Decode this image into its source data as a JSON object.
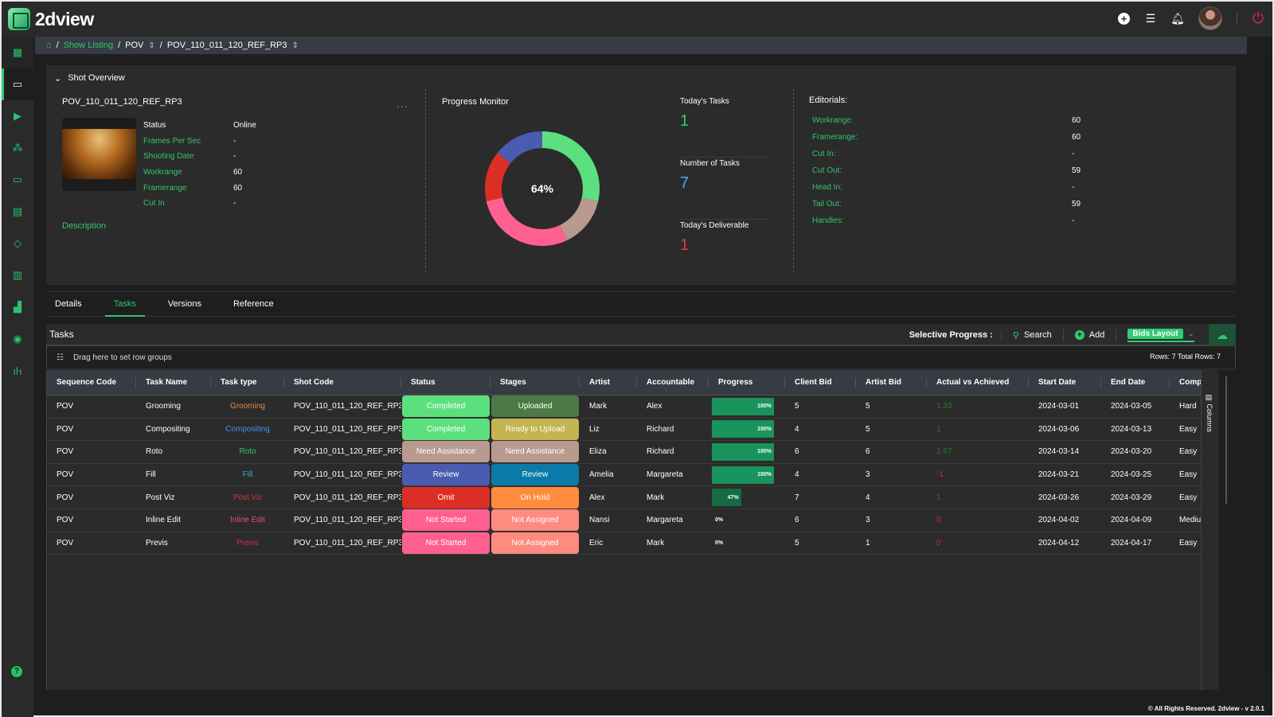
{
  "app": {
    "name": "2dview"
  },
  "topbar": {
    "icons": [
      "add-icon",
      "list-icon",
      "bell-icon",
      "avatar",
      "power-icon"
    ]
  },
  "sidebar": {
    "items": [
      {
        "name": "dashboard-icon",
        "glyph": "▦"
      },
      {
        "name": "monitor-icon",
        "glyph": "🖵"
      },
      {
        "name": "play-icon",
        "glyph": "▶"
      },
      {
        "name": "hierarchy-icon",
        "glyph": "⁂"
      },
      {
        "name": "calendar-icon",
        "glyph": "▭"
      },
      {
        "name": "schedule-icon",
        "glyph": "▤"
      },
      {
        "name": "tag-icon",
        "glyph": "◇"
      },
      {
        "name": "book-icon",
        "glyph": "▥"
      },
      {
        "name": "chart-icon",
        "glyph": "▁▃▅"
      },
      {
        "name": "eye-icon",
        "glyph": "◉"
      },
      {
        "name": "broadcast-icon",
        "glyph": "((•))"
      }
    ],
    "help": "?"
  },
  "breadcrumb": {
    "home": "⌂",
    "items": [
      "Show Listing",
      "POV",
      "POV_110_011_120_REF_RP3"
    ],
    "separator": "/"
  },
  "overview": {
    "title": "Shot Overview",
    "shot_name": "POV_110_011_120_REF_RP3",
    "more": "...",
    "fields": [
      {
        "label": "Status",
        "value": "Online"
      },
      {
        "label": "Frames Per Sec",
        "value": "-"
      },
      {
        "label": "Shooting Date",
        "value": "-"
      },
      {
        "label": "Workrange",
        "value": "60"
      },
      {
        "label": "Framerange",
        "value": "60"
      },
      {
        "label": "Cut In",
        "value": "-"
      }
    ],
    "description_label": "Description",
    "progress_monitor": {
      "title": "Progress Monitor",
      "center_label": "64%"
    },
    "stats": [
      {
        "label": "Today's Tasks",
        "value": "1",
        "color": "#2ecc71"
      },
      {
        "label": "Number of Tasks",
        "value": "7",
        "color": "#4aa8f0"
      },
      {
        "label": "Today's Deliverable",
        "value": "1",
        "color": "#e03a3a"
      }
    ],
    "editorials": {
      "title": "Editorials:",
      "rows": [
        {
          "label": "Workrange:",
          "value": "60"
        },
        {
          "label": "Framerange:",
          "value": "60"
        },
        {
          "label": "Cut In:",
          "value": "-"
        },
        {
          "label": "Cut Out:",
          "value": "59"
        },
        {
          "label": "Head In:",
          "value": "-"
        },
        {
          "label": "Tail Out:",
          "value": "59"
        },
        {
          "label": "Handles:",
          "value": "-"
        }
      ]
    }
  },
  "chart_data": {
    "type": "pie",
    "title": "Progress Monitor",
    "center_label": "64%",
    "categories": [
      "Completed",
      "Need Assistance",
      "Not Started",
      "Omit",
      "Review"
    ],
    "values": [
      2,
      1,
      2,
      1,
      1
    ],
    "colors": [
      "#5ce07f",
      "#b89a8e",
      "#ff6090",
      "#dc2e24",
      "#4a5cb0"
    ]
  },
  "tabs": [
    {
      "label": "Details",
      "active": false
    },
    {
      "label": "Tasks",
      "active": true
    },
    {
      "label": "Versions",
      "active": false
    },
    {
      "label": "Reference",
      "active": false
    }
  ],
  "tasks": {
    "title": "Tasks",
    "selective_progress": "Selective Progress :",
    "search_label": "Search",
    "add_label": "Add",
    "layout_label": "Bids Layout",
    "group_hint": "Drag here to set row groups",
    "rows_info": "Rows: 7   Total Rows: 7",
    "columns_panel": "Columns",
    "columns": [
      "Sequence Code",
      "Task Name",
      "Task type",
      "Shot Code",
      "Status",
      "Stages",
      "Artist",
      "Accountable",
      "Progress",
      "Client Bid",
      "Artist Bid",
      "Actual vs Achieved",
      "Start Date",
      "End Date",
      "Complexi"
    ],
    "rows": [
      {
        "seq": "POV",
        "task": "Grooming",
        "type": "Grooming",
        "type_color": "#e88a3a",
        "shot": "POV_110_011_120_REF_RP3",
        "status": "Completed",
        "status_color": "#5ce07f",
        "stage": "Uploaded",
        "stage_color": "#4b7a44",
        "artist": "Mark",
        "accountable": "Alex",
        "progress": 100,
        "progress_label": "100%",
        "client_bid": "5",
        "artist_bid": "5",
        "ava": "1.33",
        "ava_color": "#2a7a2a",
        "start": "2024-03-01",
        "end": "2024-03-05",
        "complexity": "Hard"
      },
      {
        "seq": "POV",
        "task": "Compositing",
        "type": "Compositing",
        "type_color": "#4a8ef0",
        "shot": "POV_110_011_120_REF_RP3",
        "status": "Completed",
        "status_color": "#5ce07f",
        "stage": "Ready to Upload",
        "stage_color": "#c4b452",
        "artist": "Liz",
        "accountable": "Richard",
        "progress": 100,
        "progress_label": "100%",
        "client_bid": "4",
        "artist_bid": "5",
        "ava": "1",
        "ava_color": "#2a7a2a",
        "start": "2024-03-06",
        "end": "2024-03-13",
        "complexity": "Easy"
      },
      {
        "seq": "POV",
        "task": "Roto",
        "type": "Roto",
        "type_color": "#3cc45a",
        "shot": "POV_110_011_120_REF_RP3",
        "status": "Need Assistance",
        "status_color": "#b89a8e",
        "stage": "Need Assistance",
        "stage_color": "#b89a8e",
        "artist": "Eliza",
        "accountable": "Richard",
        "progress": 100,
        "progress_label": "100%",
        "client_bid": "6",
        "artist_bid": "6",
        "ava": "1.67",
        "ava_color": "#2a7a2a",
        "start": "2024-03-14",
        "end": "2024-03-20",
        "complexity": "Easy"
      },
      {
        "seq": "POV",
        "task": "Fill",
        "type": "Fill",
        "type_color": "#3ab0c8",
        "shot": "POV_110_011_120_REF_RP3",
        "status": "Review",
        "status_color": "#4a5cb0",
        "stage": "Review",
        "stage_color": "#0a7aa8",
        "artist": "Amelia",
        "accountable": "Margareta",
        "progress": 100,
        "progress_label": "100%",
        "client_bid": "4",
        "artist_bid": "3",
        "ava": "-1",
        "ava_color": "#d42a2a",
        "start": "2024-03-21",
        "end": "2024-03-25",
        "complexity": "Easy"
      },
      {
        "seq": "POV",
        "task": "Post Viz",
        "type": "Post Viz",
        "type_color": "#d43a3a",
        "shot": "POV_110_011_120_REF_RP3",
        "status": "Omit",
        "status_color": "#dc2e24",
        "stage": "On Hold",
        "stage_color": "#ff8c3c",
        "artist": "Alex",
        "accountable": "Mark",
        "progress": 47,
        "progress_label": "47%",
        "client_bid": "7",
        "artist_bid": "4",
        "ava": "1",
        "ava_color": "#2a7a2a",
        "start": "2024-03-26",
        "end": "2024-03-29",
        "complexity": "Easy"
      },
      {
        "seq": "POV",
        "task": "Inline Edit",
        "type": "Inline Edit",
        "type_color": "#e84a8a",
        "shot": "POV_110_011_120_REF_RP3",
        "status": "Not Started",
        "status_color": "#ff6090",
        "stage": "Not Assigned",
        "stage_color": "#ff8a80",
        "artist": "Nansi",
        "accountable": "Margareta",
        "progress": 0,
        "progress_label": "0%",
        "client_bid": "6",
        "artist_bid": "3",
        "ava": "0",
        "ava_color": "#d42a2a",
        "start": "2024-04-02",
        "end": "2024-04-09",
        "complexity": "Medium"
      },
      {
        "seq": "POV",
        "task": "Previs",
        "type": "Previs",
        "type_color": "#d42a5a",
        "shot": "POV_110_011_120_REF_RP3",
        "status": "Not Started",
        "status_color": "#ff6090",
        "stage": "Not Assigned",
        "stage_color": "#ff8a80",
        "artist": "Eric",
        "accountable": "Mark",
        "progress": 0,
        "progress_label": "0%",
        "client_bid": "5",
        "artist_bid": "1",
        "ava": "0",
        "ava_color": "#d42a2a",
        "start": "2024-04-12",
        "end": "2024-04-17",
        "complexity": "Easy"
      }
    ]
  },
  "footer": "© All Rights Reserved. 2dview - v 2.0.1"
}
